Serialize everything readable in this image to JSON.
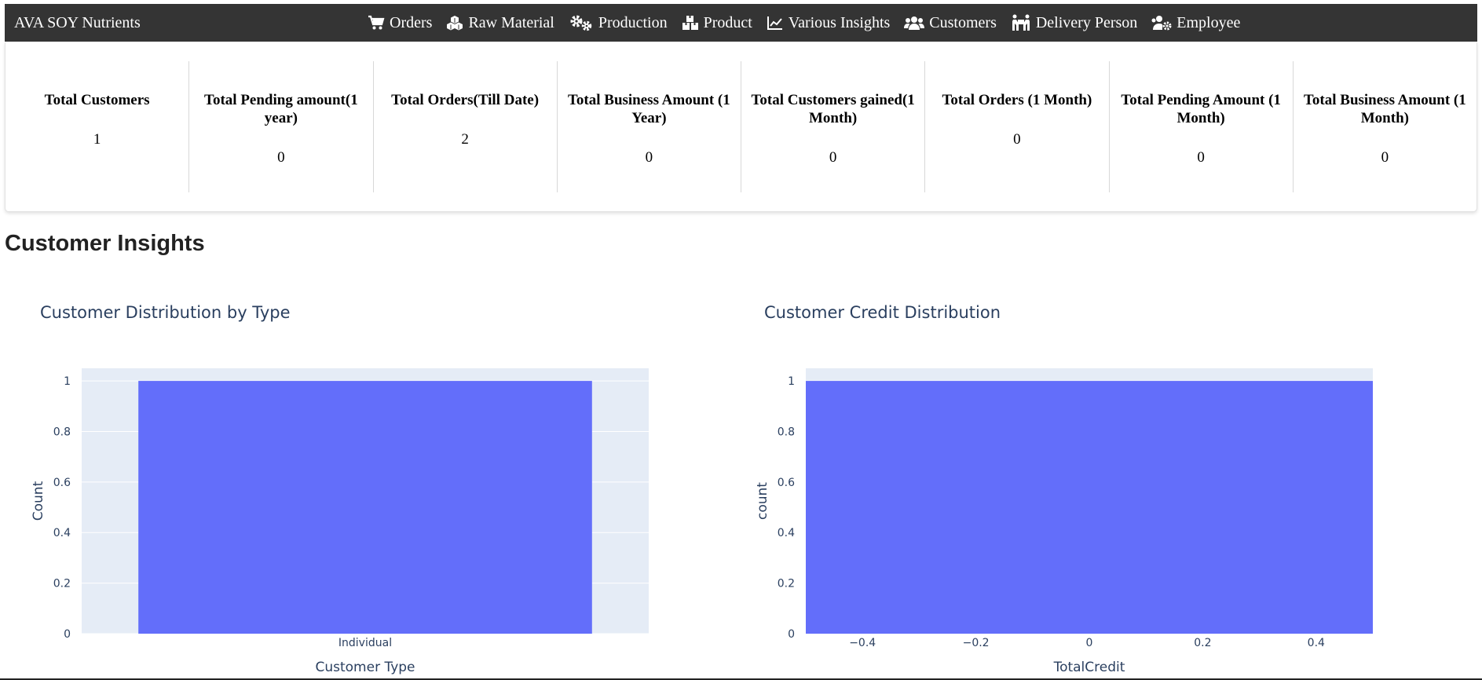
{
  "navbar": {
    "brand": "AVA SOY Nutrients",
    "items": [
      {
        "label": "Orders",
        "icon": "cart-icon"
      },
      {
        "label": "Raw Material",
        "icon": "cubes-icon"
      },
      {
        "label": "Production",
        "icon": "gears-icon"
      },
      {
        "label": "Product",
        "icon": "boxes-icon"
      },
      {
        "label": "Various Insights",
        "icon": "line-chart-icon"
      },
      {
        "label": "Customers",
        "icon": "users-icon"
      },
      {
        "label": "Delivery Person",
        "icon": "people-carry-icon"
      },
      {
        "label": "Employee",
        "icon": "users-cog-icon"
      }
    ]
  },
  "stats": [
    {
      "label": "Total Customers",
      "value": "1"
    },
    {
      "label": "Total Pending amount(1 year)",
      "value": "0"
    },
    {
      "label": "Total Orders(Till Date)",
      "value": "2"
    },
    {
      "label": "Total Business Amount (1 Year)",
      "value": "0"
    },
    {
      "label": "Total Customers gained(1 Month)",
      "value": "0"
    },
    {
      "label": "Total Orders (1 Month)",
      "value": "0"
    },
    {
      "label": "Total Pending Amount (1 Month)",
      "value": "0"
    },
    {
      "label": "Total Business Amount (1 Month)",
      "value": "0"
    }
  ],
  "section_title": "Customer Insights",
  "colors": {
    "navbar_bg": "#343434",
    "bar": "#636efa",
    "plot_bg": "#e5ecf6",
    "axis_text": "#2a3f5f"
  },
  "chart_data": [
    {
      "type": "bar",
      "title": "Customer Distribution by Type",
      "categories": [
        "Individual"
      ],
      "values": [
        1
      ],
      "xlabel": "Customer Type",
      "ylabel": "Count",
      "ylim": [
        0,
        1.05
      ],
      "yticks": [
        0,
        0.2,
        0.4,
        0.6,
        0.8,
        1
      ],
      "ytick_labels": [
        "0",
        "0.2",
        "0.4",
        "0.6",
        "0.8",
        "1"
      ],
      "grid": true
    },
    {
      "type": "bar",
      "title": "Customer Credit Distribution",
      "bins": [
        {
          "start": -0.5,
          "end": 0.5,
          "count": 1
        }
      ],
      "xlabel": "TotalCredit",
      "ylabel": "count",
      "xlim": [
        -0.5,
        0.5
      ],
      "ylim": [
        0,
        1.05
      ],
      "xticks": [
        -0.4,
        -0.2,
        0,
        0.2,
        0.4
      ],
      "xtick_labels": [
        "−0.4",
        "−0.2",
        "0",
        "0.2",
        "0.4"
      ],
      "yticks": [
        0,
        0.2,
        0.4,
        0.6,
        0.8,
        1
      ],
      "ytick_labels": [
        "0",
        "0.2",
        "0.4",
        "0.6",
        "0.8",
        "1"
      ],
      "grid": true
    }
  ]
}
